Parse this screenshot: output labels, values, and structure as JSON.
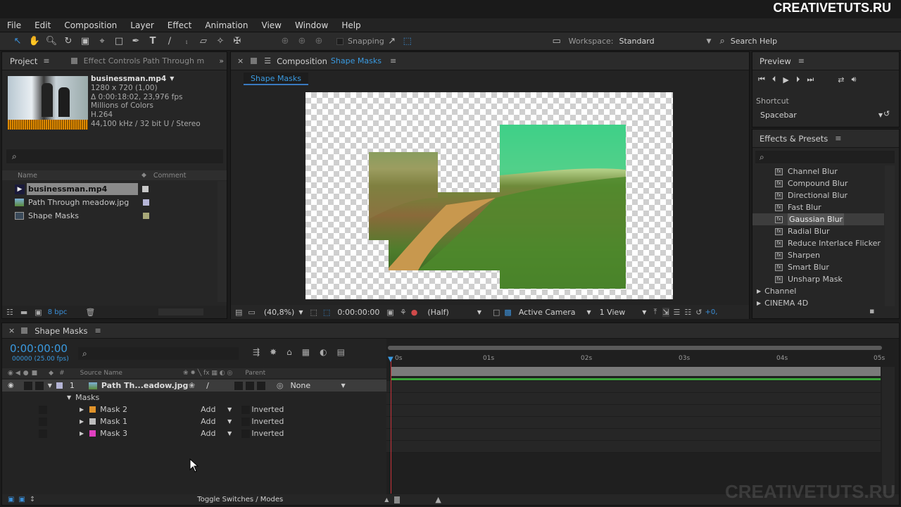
{
  "brand": "CREATIVETUTS.RU",
  "watermark": "CREATIVETUTS.RU",
  "menu": [
    "File",
    "Edit",
    "Composition",
    "Layer",
    "Effect",
    "Animation",
    "View",
    "Window",
    "Help"
  ],
  "toolbar": {
    "snapping_label": "Snapping",
    "workspace_label": "Workspace:",
    "workspace_value": "Standard",
    "search_help": "Search Help"
  },
  "project": {
    "tab_project": "Project",
    "tab_effect_controls": "Effect Controls Path Through m",
    "asset": {
      "name": "businessman.mp4",
      "line1": "1280 x 720 (1,00)",
      "line2": "Δ 0:00:18:02, 23,976 fps",
      "line3": "Millions of Colors",
      "line4": "H.264",
      "line5": "44,100 kHz / 32 bit U / Stereo"
    },
    "col_name": "Name",
    "col_comment": "Comment",
    "items": [
      {
        "name": "businessman.mp4",
        "color": "#c8c8c8"
      },
      {
        "name": "Path Through meadow.jpg",
        "color": "#b5b5d6"
      },
      {
        "name": "Shape Masks",
        "color": "#a8a878"
      }
    ],
    "bpc": "8 bpc"
  },
  "composition": {
    "tab_prefix": "Composition",
    "tab_name": "Shape Masks",
    "subtab": "Shape Masks",
    "zoom": "(40,8%)",
    "timecode": "0:00:00:00",
    "resolution": "(Half)",
    "camera": "Active Camera",
    "views": "1 View",
    "offset": "+0,"
  },
  "preview": {
    "title": "Preview",
    "shortcut_label": "Shortcut",
    "shortcut_value": "Spacebar"
  },
  "effects": {
    "title": "Effects & Presets",
    "items": [
      "Channel Blur",
      "Compound Blur",
      "Directional Blur",
      "Fast Blur",
      "Gaussian Blur",
      "Radial Blur",
      "Reduce Interlace Flicker",
      "Sharpen",
      "Smart Blur",
      "Unsharp Mask"
    ],
    "selected": "Gaussian Blur",
    "groups": [
      "Channel",
      "CINEMA 4D"
    ]
  },
  "timeline": {
    "tab": "Shape Masks",
    "timecode": "0:00:00:00",
    "frames": "00000 (25.00 fps)",
    "col_source": "Source Name",
    "col_parent": "Parent",
    "layer_num": "1",
    "layer_name": "Path Th...eadow.jpg",
    "parent_value": "None",
    "masks_label": "Masks",
    "masks": [
      {
        "name": "Mask 2",
        "mode": "Add",
        "inverted": "Inverted",
        "color": "#e0932a"
      },
      {
        "name": "Mask 1",
        "mode": "Add",
        "inverted": "Inverted",
        "color": "#bdbdbd"
      },
      {
        "name": "Mask 3",
        "mode": "Add",
        "inverted": "Inverted",
        "color": "#e040c0"
      }
    ],
    "ruler": [
      "0s",
      "01s",
      "02s",
      "03s",
      "04s",
      "05s"
    ],
    "toggle_label": "Toggle Switches / Modes"
  }
}
